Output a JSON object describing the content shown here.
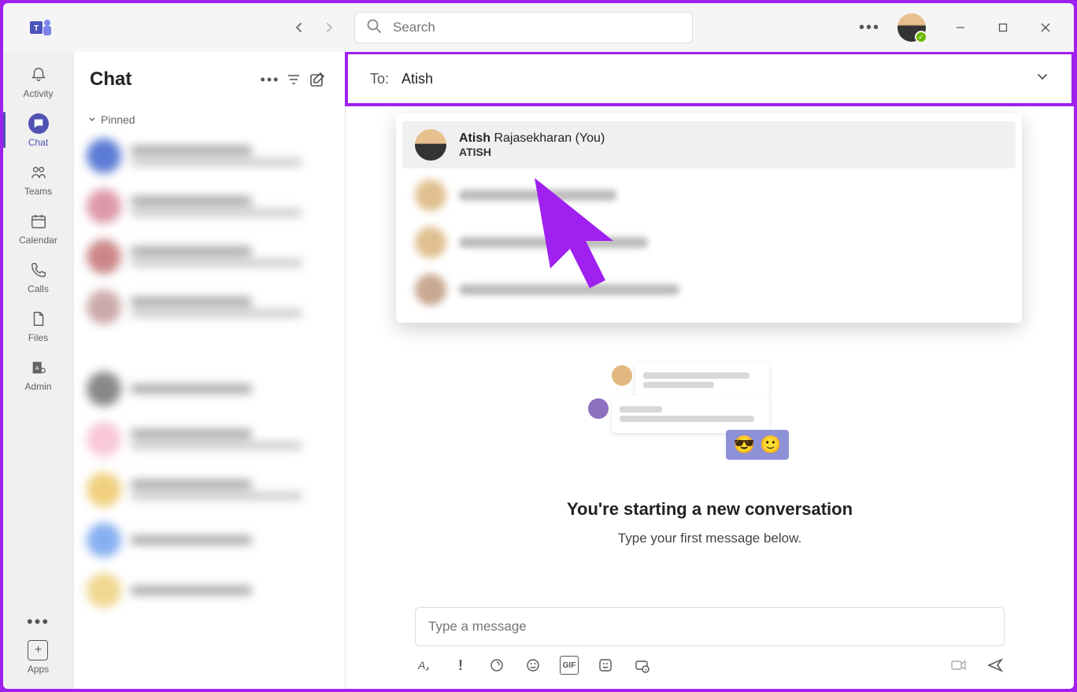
{
  "search": {
    "placeholder": "Search"
  },
  "rail": {
    "activity": "Activity",
    "chat": "Chat",
    "teams": "Teams",
    "calendar": "Calendar",
    "calls": "Calls",
    "files": "Files",
    "admin": "Admin",
    "apps": "Apps"
  },
  "chatlist": {
    "title": "Chat",
    "pinned_label": "Pinned"
  },
  "to_bar": {
    "label": "To:",
    "value": "Atish"
  },
  "suggestions": {
    "first": {
      "name_bold": "Atish",
      "name_rest": " Rajasekharan (You)",
      "sub": "ATISH"
    }
  },
  "new_convo": {
    "heading": "You're starting a new conversation",
    "sub": "Type your first message below."
  },
  "compose": {
    "placeholder": "Type a message",
    "gif_label": "GIF"
  }
}
